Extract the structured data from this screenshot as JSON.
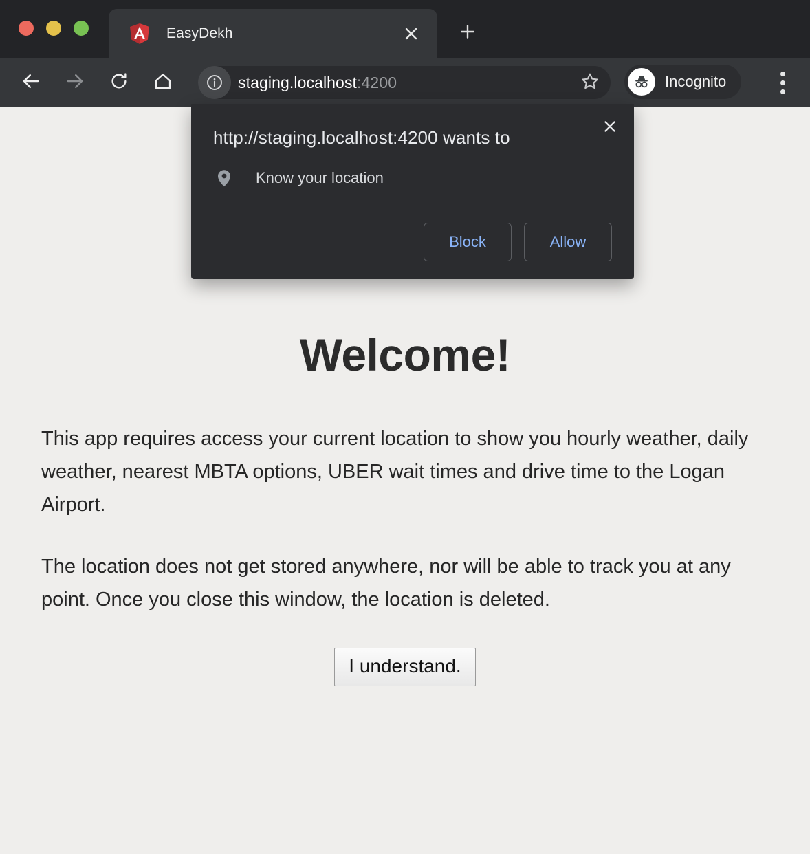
{
  "window": {
    "traffic_lights": [
      {
        "name": "close",
        "color": "#ed6a5e"
      },
      {
        "name": "minimize",
        "color": "#e4c14b"
      },
      {
        "name": "zoom",
        "color": "#78c153"
      }
    ]
  },
  "tab": {
    "title": "EasyDekh",
    "favicon": "angular-logo-icon",
    "close_icon": "close-icon",
    "new_tab_icon": "plus-icon"
  },
  "toolbar": {
    "back_icon": "arrow-left-icon",
    "forward_icon": "arrow-right-icon",
    "reload_icon": "reload-icon",
    "home_icon": "home-icon",
    "info_icon": "info-circle-icon",
    "bookmark_icon": "star-icon",
    "menu_icon": "three-dots-icon",
    "url_host": "staging.localhost",
    "url_port": ":4200",
    "profile_label": "Incognito",
    "profile_icon": "incognito-hat-glasses-icon"
  },
  "permission_dialog": {
    "title": "http://staging.localhost:4200 wants to",
    "permission_icon": "location-pin-icon",
    "permission_label": "Know your location",
    "close_icon": "close-icon",
    "block_label": "Block",
    "allow_label": "Allow",
    "accent_color": "#8ab4f8",
    "background_color": "#2b2c2f"
  },
  "page": {
    "heading": "Welcome!",
    "paragraph_1": "This app requires access your current location to show you hourly weather, daily weather, nearest MBTA options, UBER wait times and drive time to the Logan Airport.",
    "paragraph_2": "The location does not get stored anywhere, nor will be able to track you at any point. Once you close this window, the location is deleted.",
    "understand_button": "I understand.",
    "background_color": "#efeeec"
  }
}
